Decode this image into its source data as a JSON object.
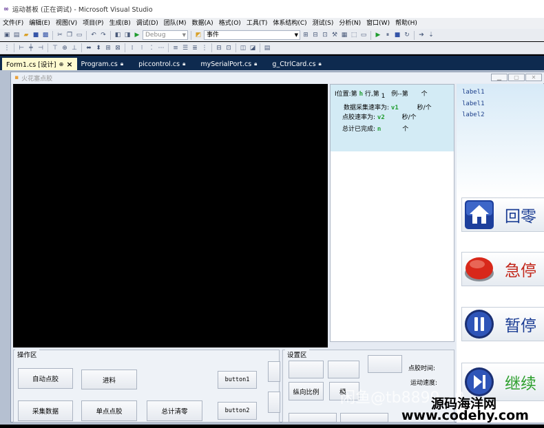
{
  "window": {
    "title": "运动甚板 (正在调试) - Microsoft Visual Studio"
  },
  "menu": [
    "文件(F)",
    "编辑(E)",
    "视图(V)",
    "项目(P)",
    "生成(B)",
    "调试(D)",
    "团队(M)",
    "数据(A)",
    "格式(O)",
    "工具(T)",
    "体系结构(C)",
    "测试(S)",
    "分析(N)",
    "窗口(W)",
    "帮助(H)"
  ],
  "toolbar": {
    "config": "Debug",
    "event_combo": "事件"
  },
  "tabs": [
    {
      "label": "Form1.cs [设计]",
      "active": true
    },
    {
      "label": "Program.cs",
      "active": false
    },
    {
      "label": "piccontrol.cs",
      "active": false
    },
    {
      "label": "mySerialPort.cs",
      "active": false
    },
    {
      "label": "g_CtrlCard.cs",
      "active": false
    }
  ],
  "form": {
    "title": "火花塞点胶",
    "info": {
      "pos_label": "Ⅰ位置:第",
      "pos_h": "h",
      "row_label": "行,第",
      "row_val": "1",
      "col_label": "例--第",
      "col_unit": "个",
      "rate_label": "数据采集速率为:",
      "rate_val": "v1",
      "rate_unit": "秒/个",
      "dot_rate_label": "点胶速率为:",
      "dot_rate_val": "v2",
      "dot_rate_unit": "秒/个",
      "done_label": "总计已完成:",
      "done_val": "n",
      "done_unit": "个"
    },
    "right_labels": [
      "label1",
      "label1",
      "label2"
    ],
    "big_buttons": [
      {
        "label": "回零",
        "color": "#1b3d94",
        "icon": "home-icon"
      },
      {
        "label": "急停",
        "color": "#c2261a",
        "icon": "stop-icon"
      },
      {
        "label": "暂停",
        "color": "#1b3d94",
        "icon": "pause-icon"
      },
      {
        "label": "继续",
        "color": "#2ea02e",
        "icon": "play-next-icon"
      }
    ],
    "operation": {
      "title": "操作区",
      "auto_dispense": "自动点胶",
      "feed": "进料",
      "button1": "button1",
      "collect": "采集数据",
      "single_dispense": "单点点胶",
      "total_clear": "总计清零",
      "button2": "button2"
    },
    "settings": {
      "title": "设置区",
      "dispense_time": "点胶时间:",
      "move_speed": "运动速度:",
      "vertical_ratio": "纵向比例",
      "horizontal_ratio": "横"
    }
  },
  "watermark": {
    "line1": "闲鱼@tb8899…9",
    "line2": "源码海洋网",
    "line3": "www.codehy.com"
  }
}
